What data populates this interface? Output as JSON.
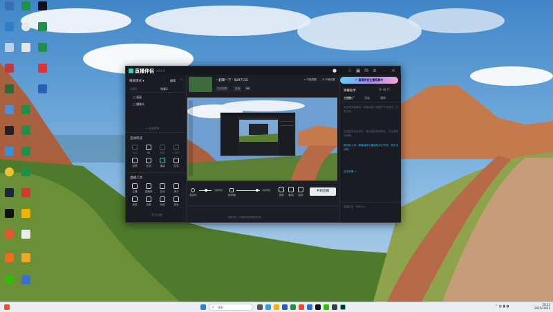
{
  "app": {
    "name": "直播伴侣",
    "version": "v9.9.9",
    "mode_label": "横屏模式",
    "edit_label": "编辑",
    "add_scene_label": "+",
    "scene_tabs": [
      "场景1",
      "场景2"
    ],
    "add_material_label": "+ 新建素材",
    "sources": [
      "画面",
      "摄像头"
    ],
    "interaction_section": "互动玩法",
    "interaction_tools": [
      "连线",
      "PK",
      "抽奖",
      "小组件",
      "投票",
      "礼物",
      "福袋",
      "红包"
    ],
    "live_tools_section": "直播工具",
    "live_tools": [
      "主播",
      "直播间",
      "互动",
      "观众",
      "美颜",
      "录像",
      "特效",
      "更多"
    ],
    "more_label": "更多功能",
    "stream": {
      "title": "一起聊一下 · 8297155",
      "tags": [
        "在线观看",
        "直播"
      ],
      "count": "26",
      "right_labels": [
        "开播提醒",
        "开播设置"
      ],
      "banner": "✔ 直播伴侣主播招募中"
    },
    "controls": {
      "mic_label": "麦克风",
      "mic_value": "100%",
      "speaker_label": "扬声器",
      "speaker_value": "100%",
      "tool_labels": [
        "录制",
        "截图",
        "画质"
      ],
      "start_button": "开始直播",
      "hint": "直播伴侣 · 开播前请检查推流设置"
    },
    "right_panel": {
      "title": "弹幕助手",
      "tabs": [
        "主播推广",
        "活动",
        "通知"
      ],
      "msg1": "欢迎来到直播间！直播过程中请遵守平台规范，文明互动。",
      "msg2": "当前推流状态良好，建议保持网络稳定，开启美颜与降噪。",
      "msg3": "新功能上线：弹幕抽奖与福袋玩法已开放，快去试试吧。",
      "link": "点击查看 >",
      "footer": "直播伴侣 · 帮助中心"
    }
  },
  "taskbar": {
    "search_label": "搜索",
    "clock_time": "20:51",
    "clock_date": "2025/10/21"
  }
}
